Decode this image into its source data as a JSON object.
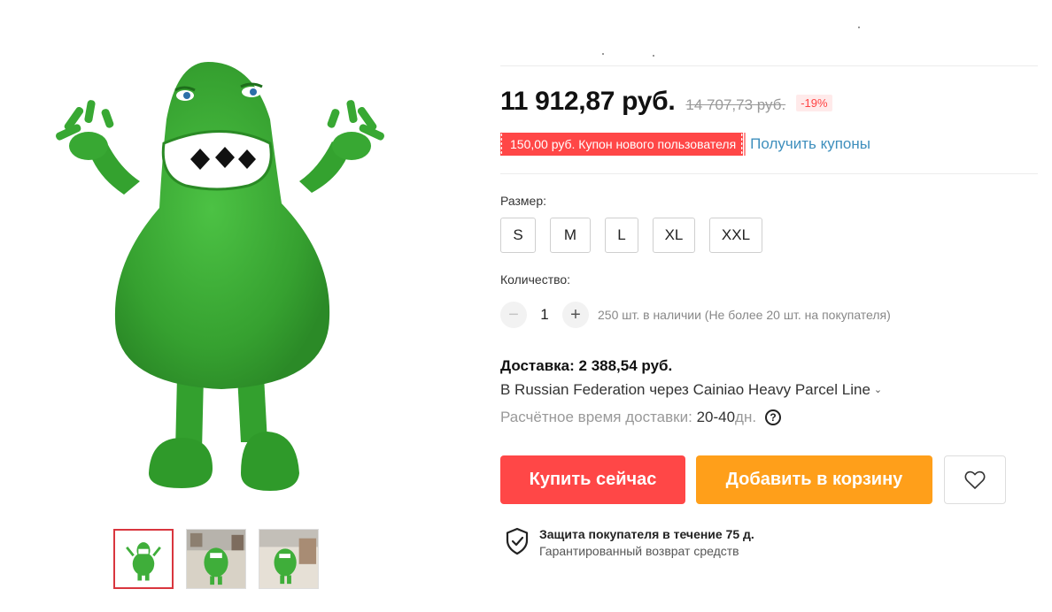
{
  "product": {
    "price_current": "11 912,87 руб.",
    "price_original": "14 707,73 руб.",
    "discount": "-19%"
  },
  "coupon": {
    "tag_text": "150,00 руб. Купон нового пользователя",
    "link_text": "Получить купоны"
  },
  "size": {
    "label": "Размер:",
    "options": [
      "S",
      "M",
      "L",
      "XL",
      "XXL"
    ]
  },
  "quantity": {
    "label": "Количество:",
    "minus": "−",
    "value": "1",
    "plus": "+",
    "stock_note": "250 шт. в наличии (Не более 20 шт. на покупателя)"
  },
  "shipping": {
    "title": "Доставка: 2 388,54 руб.",
    "method": "В Russian Federation через Cainiao Heavy Parcel Line",
    "eta_label": "Расчётное время доставки: ",
    "eta_days": "20-40",
    "eta_unit": "дн.",
    "help": "?"
  },
  "actions": {
    "buy_now": "Купить сейчас",
    "add_to_cart": "Добавить в корзину"
  },
  "protection": {
    "title": "Защита покупателя в течение 75 д.",
    "subtitle": "Гарантированный возврат средств"
  },
  "colors": {
    "accent_red": "#ff4747",
    "accent_orange": "#ff9f1a",
    "link_blue": "#3e8fbd",
    "costume_green": "#3fae3a"
  },
  "icons": [
    "chevron-down-icon",
    "help-icon",
    "heart-icon",
    "shield-check-icon"
  ]
}
